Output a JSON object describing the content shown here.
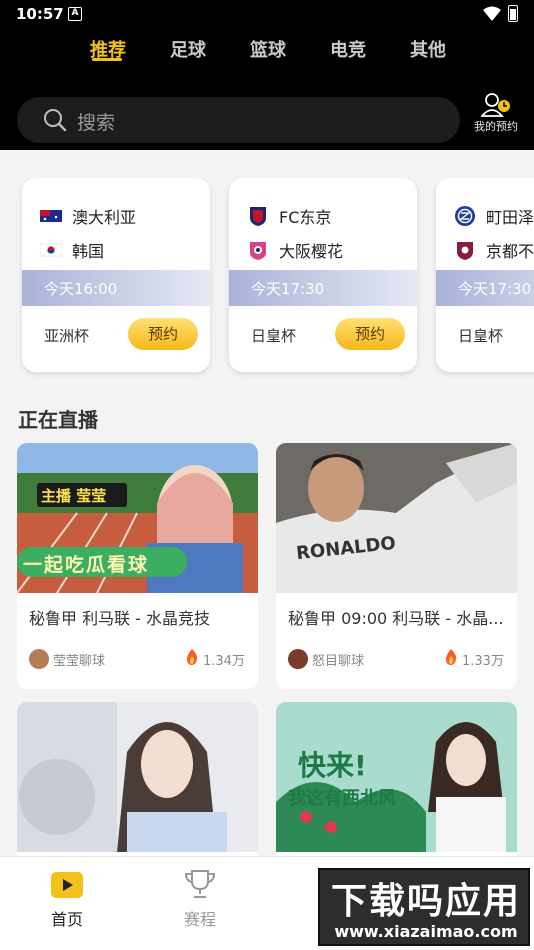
{
  "status_bar": {
    "time": "10:57",
    "notif_glyph": "A"
  },
  "tabs": [
    {
      "label": "推荐",
      "active": true
    },
    {
      "label": "足球"
    },
    {
      "label": "篮球"
    },
    {
      "label": "电竞"
    },
    {
      "label": "其他"
    }
  ],
  "search": {
    "placeholder": "搜索"
  },
  "my_reservations": {
    "label": "我的预约"
  },
  "matches": [
    {
      "home": "澳大利亚",
      "away": "韩国",
      "time": "今天16:00",
      "cup": "亚洲杯",
      "button": "预约"
    },
    {
      "home": "FC东京",
      "away": "大阪樱花",
      "time": "今天17:30",
      "cup": "日皇杯",
      "button": "预约"
    },
    {
      "home": "町田泽",
      "away": "京都不",
      "time": "今天17:30",
      "cup": "日皇杯"
    }
  ],
  "live_section": {
    "title": "正在直播"
  },
  "streams": [
    {
      "title": "秘鲁甲  利马联 - 水晶竞技",
      "host": "莹莹聊球",
      "views": "1.34万",
      "overlay_top": "主播 莹莹",
      "overlay_bottom": "一起吃瓜看球"
    },
    {
      "title": "秘鲁甲 09:00 利马联 - 水晶...",
      "host": "怒目聊球",
      "views": "1.33万",
      "overlay_jersey": "RONALDO"
    },
    {
      "title": "",
      "host": "",
      "views": ""
    },
    {
      "title": "",
      "host": "",
      "views": "",
      "overlay_top": "快来!",
      "overlay_bottom": "我这有西北风"
    }
  ],
  "bottom_nav": [
    {
      "label": "首页",
      "icon": "play-icon",
      "active": true
    },
    {
      "label": "赛程",
      "icon": "trophy-icon"
    }
  ],
  "watermark": {
    "line1": "下载吗应用",
    "line2": "www.xiazaimao.com"
  },
  "colors": {
    "accent": "#f3c21a",
    "header_bg": "#000000",
    "book_button": "#f6b71a"
  }
}
